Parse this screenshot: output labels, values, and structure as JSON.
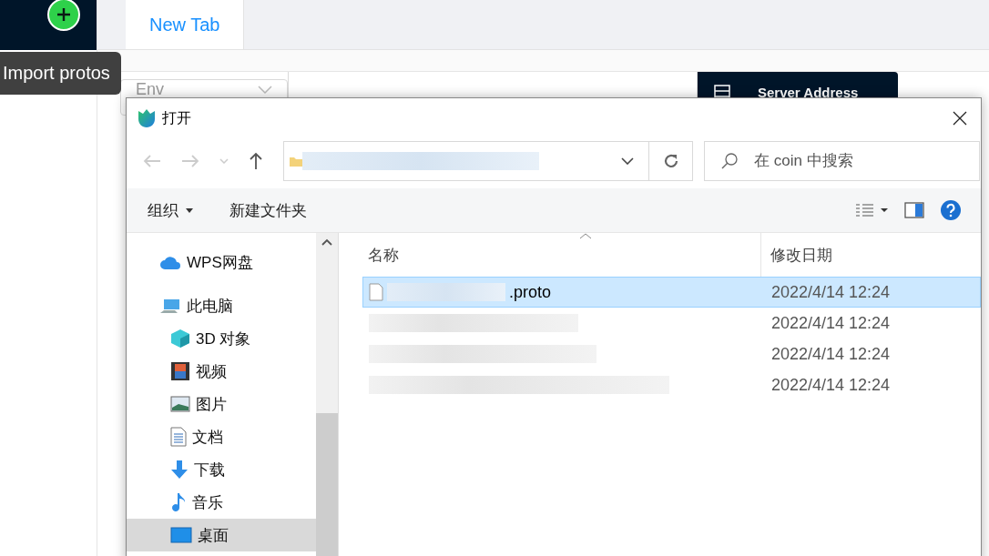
{
  "app": {
    "tooltip": "Import protos",
    "tabs": [
      {
        "label": "New Tab",
        "selected": true
      }
    ],
    "env_select": {
      "placeholder": "Env"
    },
    "server_button": {
      "label": "Server Address"
    }
  },
  "dialog": {
    "title": "打开",
    "search": {
      "placeholder": "在 coin 中搜索"
    },
    "toolbar": [
      {
        "label": "组织",
        "kind": "menu"
      },
      {
        "label": "新建文件夹",
        "kind": "plain"
      }
    ],
    "nav": [
      {
        "label": "WPS网盘",
        "kind": "cloud",
        "selected": false
      },
      {
        "label": "此电脑",
        "kind": "pc",
        "selected": false,
        "children": [
          {
            "label": "3D 对象",
            "kind": "cube",
            "selected": false
          },
          {
            "label": "视频",
            "kind": "film",
            "selected": false
          },
          {
            "label": "图片",
            "kind": "image",
            "selected": false
          },
          {
            "label": "文档",
            "kind": "doc",
            "selected": false
          },
          {
            "label": "下载",
            "kind": "download",
            "selected": false
          },
          {
            "label": "音乐",
            "kind": "music",
            "selected": false
          },
          {
            "label": "桌面",
            "kind": "desktop",
            "selected": true
          }
        ]
      }
    ],
    "columns": [
      "名称",
      "修改日期"
    ],
    "files": [
      {
        "name": ".proto",
        "date": "2022/4/14 12:24",
        "selected": true
      },
      {
        "date": "2022/4/14 12:24",
        "selected": false
      },
      {
        "date": "2022/4/14 12:24",
        "selected": false
      },
      {
        "date": "2022/4/14 12:24",
        "selected": false
      }
    ]
  }
}
